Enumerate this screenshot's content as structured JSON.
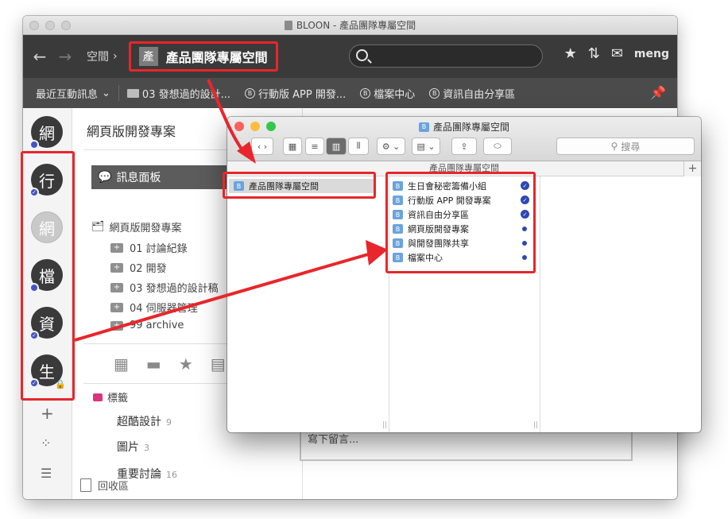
{
  "window": {
    "title": "BLOON - 產品團隊專屬空間"
  },
  "toolbar": {
    "space_label": "空間",
    "crumb_avatar": "產",
    "crumb_title": "產品團隊專屬空間",
    "user": "meng"
  },
  "subbar": {
    "recent": "最近互動訊息",
    "favorites": [
      "03 發想過的設計...",
      "行動版 APP 開發...",
      "檔案中心",
      "資訊自由分享區"
    ]
  },
  "rail": {
    "workspaces": [
      "網",
      "行",
      "網",
      "檔",
      "資",
      "生"
    ]
  },
  "nav": {
    "space_title": "網頁版開發專案",
    "board": "訊息面板",
    "tree_root": "網頁版開發專案",
    "tree_items": [
      "01 討論紀錄",
      "02 開發",
      "03 發想過的設計稿",
      "04 伺服器管理",
      "99 archive"
    ],
    "tags_title": "標籤",
    "tags": [
      {
        "name": "超酷設計",
        "count": "9"
      },
      {
        "name": "圖片",
        "count": "3"
      },
      {
        "name": "重要討論",
        "count": "16"
      }
    ],
    "trash": "回收區"
  },
  "comment": {
    "placeholder": "寫下留言..."
  },
  "finder": {
    "title": "產品團隊專屬空間",
    "search_placeholder": "搜尋",
    "column_header": "產品團隊專屬空間",
    "col1_item": "產品團隊專屬空間",
    "items": [
      {
        "name": "生日會秘密籌備小組",
        "status": "check"
      },
      {
        "name": "行動版 APP 開發專案",
        "status": "check"
      },
      {
        "name": "資訊自由分享區",
        "status": "check"
      },
      {
        "name": "網頁版開發專案",
        "status": "dot"
      },
      {
        "name": "與開發團隊共享",
        "status": "dot"
      },
      {
        "name": "檔案中心",
        "status": "dot"
      }
    ]
  },
  "colors": {
    "highlight": "#e8262b",
    "badge": "#2e47b3",
    "toolbar": "#3a3a3a"
  }
}
